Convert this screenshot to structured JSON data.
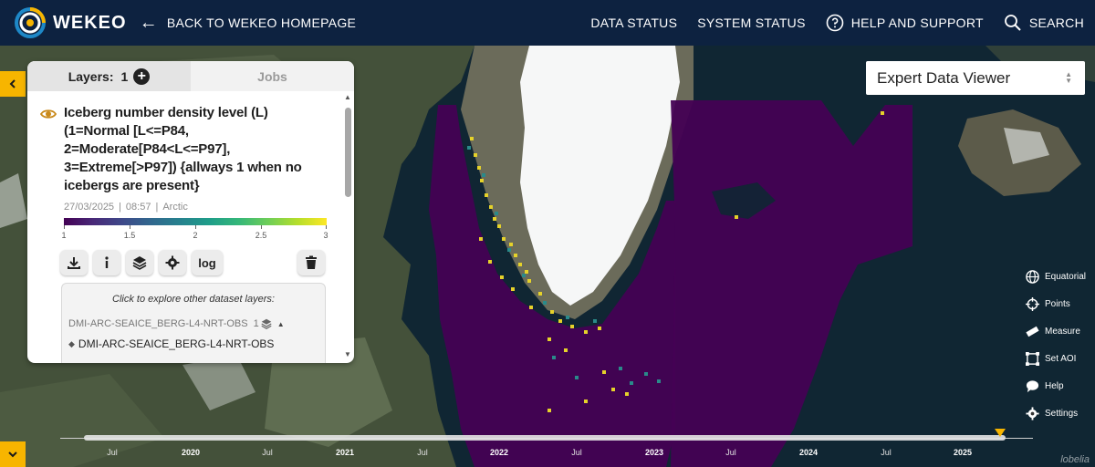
{
  "header": {
    "logo_text": "WEKEO",
    "back_label": "BACK TO WEKEO HOMEPAGE",
    "nav": [
      {
        "label": "DATA STATUS"
      },
      {
        "label": "SYSTEM STATUS"
      },
      {
        "label": "HELP AND SUPPORT",
        "icon": "question-circle-icon"
      },
      {
        "label": "SEARCH",
        "icon": "search-icon"
      }
    ]
  },
  "panel": {
    "tabs": {
      "layers_label": "Layers:",
      "layers_count": "1",
      "jobs_label": "Jobs"
    },
    "layer": {
      "title": "Iceberg number density level (L) (1=Normal [L<=P84, 2=Moderate[P84<L<=P97], 3=Extreme[>P97]) {allways 1 when no icebergs are present}",
      "date": "27/03/2025",
      "time": "08:57",
      "region": "Arctic",
      "colorbar_ticks": [
        "1",
        "1.5",
        "2",
        "2.5",
        "3"
      ],
      "colorbar_min": 1,
      "colorbar_max": 3,
      "tools": [
        "download-icon",
        "info-icon",
        "layers-icon",
        "gear-icon"
      ],
      "log_label": "log"
    },
    "explore": {
      "hint": "Click to explore other dataset layers:",
      "dataset": "DMI-ARC-SEAICE_BERG-L4-NRT-OBS",
      "dataset_count": "1",
      "sublayer": "DMI-ARC-SEAICE_BERG-L4-NRT-OBS"
    }
  },
  "viewer": {
    "selected": "Expert Data Viewer"
  },
  "right_tools": [
    {
      "label": "Equatorial",
      "icon": "globe-icon"
    },
    {
      "label": "Points",
      "icon": "crosshair-icon"
    },
    {
      "label": "Measure",
      "icon": "ruler-icon"
    },
    {
      "label": "Set AOI",
      "icon": "aoi-icon"
    },
    {
      "label": "Help",
      "icon": "chat-bubble-icon"
    },
    {
      "label": "Settings",
      "icon": "gear-icon"
    }
  ],
  "timeline": {
    "labels": [
      "Jul",
      "2020",
      "Jul",
      "2021",
      "Jul",
      "2022",
      "Jul",
      "2023",
      "Jul",
      "2024",
      "Jul",
      "2025"
    ],
    "attribution": "lobelia"
  },
  "colors": {
    "header_bg": "#0d2240",
    "accent_yellow": "#f7b500",
    "data_purple": "#440154"
  }
}
